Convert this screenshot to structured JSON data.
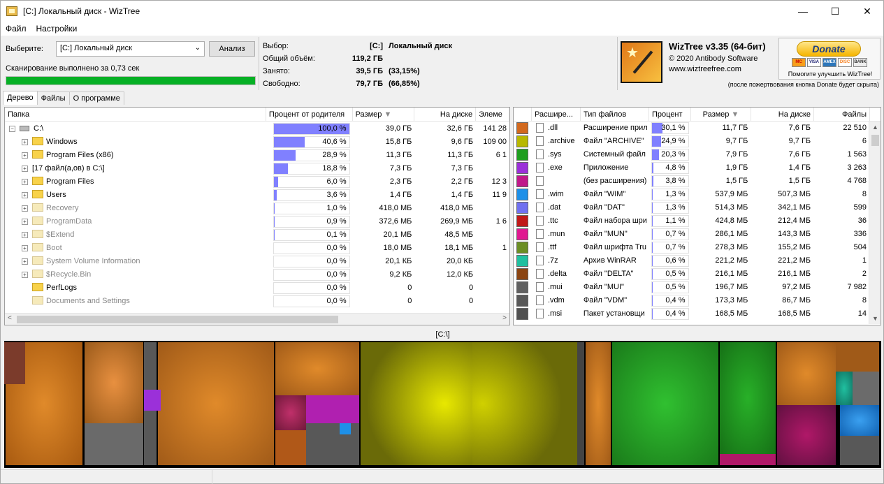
{
  "window": {
    "title": "[C:] Локальный диск  - WizTree",
    "min": "—",
    "max": "☐",
    "close": "✕"
  },
  "menu": [
    "Файл",
    "Настройки"
  ],
  "scan": {
    "select_label": "Выберите:",
    "drive_value": "[C:] Локальный диск",
    "analyze_button": "Анализ",
    "status_text": "Сканирование выполнено за 0,73 сек",
    "progress_percent": 100
  },
  "summary": {
    "selection_label": "Выбор:",
    "selection_drive": "[C:]",
    "selection_name": "Локальный диск",
    "total_label": "Общий объём:",
    "total_value": "119,2 ГБ",
    "used_label": "Занято:",
    "used_value": "39,5 ГБ",
    "used_pct": "(33,15%)",
    "free_label": "Свободно:",
    "free_value": "79,7 ГБ",
    "free_pct": "(66,85%)"
  },
  "brand": {
    "name": "WizTree v3.35 (64-бит)",
    "copyright": "© 2020 Antibody Software",
    "site": "www.wiztreefree.com",
    "donate_button": "Donate",
    "donate_caption": "Помогите улучшить WizTree!",
    "donate_note": "(после пожертвования кнопка Donate будет скрыта)",
    "cards": [
      "MC",
      "VISA",
      "AMEX",
      "DISC",
      "BANK"
    ]
  },
  "tabs": [
    "Дерево",
    "Файлы",
    "О программе"
  ],
  "tree": {
    "columns": [
      "Папка",
      "Процент от родителя",
      "Размер",
      "На диске",
      "Элеме"
    ],
    "rows": [
      {
        "name": "C:\\",
        "pct": "100,0 %",
        "pct_value": 100,
        "size": "39,0 ГБ",
        "disk": "32,6 ГБ",
        "items": "141 28",
        "level": 0,
        "kind": "drive"
      },
      {
        "name": "Windows",
        "pct": "40,6 %",
        "pct_value": 40.6,
        "size": "15,8 ГБ",
        "disk": "9,6 ГБ",
        "items": "109 00",
        "level": 1,
        "kind": "folder"
      },
      {
        "name": "Program Files (x86)",
        "pct": "28,9 %",
        "pct_value": 28.9,
        "size": "11,3 ГБ",
        "disk": "11,3 ГБ",
        "items": "6 1",
        "level": 1,
        "kind": "folder"
      },
      {
        "name": "[17 файл(а,ов) в C:\\]",
        "pct": "18,8 %",
        "pct_value": 18.8,
        "size": "7,3 ГБ",
        "disk": "7,3 ГБ",
        "items": "",
        "level": 1,
        "kind": "files"
      },
      {
        "name": "Program Files",
        "pct": "6,0 %",
        "pct_value": 6.0,
        "size": "2,3 ГБ",
        "disk": "2,2 ГБ",
        "items": "12 3",
        "level": 1,
        "kind": "folder"
      },
      {
        "name": "Users",
        "pct": "3,6 %",
        "pct_value": 3.6,
        "size": "1,4 ГБ",
        "disk": "1,4 ГБ",
        "items": "11 9",
        "level": 1,
        "kind": "folder"
      },
      {
        "name": "Recovery",
        "pct": "1,0 %",
        "pct_value": 1.0,
        "size": "418,0 МБ",
        "disk": "418,0 МБ",
        "items": "",
        "level": 1,
        "kind": "system"
      },
      {
        "name": "ProgramData",
        "pct": "0,9 %",
        "pct_value": 0.9,
        "size": "372,6 МБ",
        "disk": "269,9 МБ",
        "items": "1 6",
        "level": 1,
        "kind": "system"
      },
      {
        "name": "$Extend",
        "pct": "0,1 %",
        "pct_value": 0.1,
        "size": "20,1 МБ",
        "disk": "48,5 МБ",
        "items": "",
        "level": 1,
        "kind": "system"
      },
      {
        "name": "Boot",
        "pct": "0,0 %",
        "pct_value": 0,
        "size": "18,0 МБ",
        "disk": "18,1 МБ",
        "items": "1",
        "level": 1,
        "kind": "system"
      },
      {
        "name": "System Volume Information",
        "pct": "0,0 %",
        "pct_value": 0,
        "size": "20,1 КБ",
        "disk": "20,0 КБ",
        "items": "",
        "level": 1,
        "kind": "system"
      },
      {
        "name": "$Recycle.Bin",
        "pct": "0,0 %",
        "pct_value": 0,
        "size": "9,2 КБ",
        "disk": "12,0 КБ",
        "items": "",
        "level": 1,
        "kind": "system"
      },
      {
        "name": "PerfLogs",
        "pct": "0,0 %",
        "pct_value": 0,
        "size": "0",
        "disk": "0",
        "items": "",
        "level": 1,
        "kind": "folder-noexp"
      },
      {
        "name": "Documents and Settings",
        "pct": "0,0 %",
        "pct_value": 0,
        "size": "0",
        "disk": "0",
        "items": "",
        "level": 1,
        "kind": "system-noexp"
      }
    ]
  },
  "types": {
    "columns": [
      "",
      "Расшире...",
      "Тип файлов",
      "Процент",
      "Размер",
      "На диске",
      "Файлы"
    ],
    "rows": [
      {
        "color": "#d2691e",
        "ext": ".dll",
        "type": "Расширение прил",
        "pct": "30,1 %",
        "pct_value": 30.1,
        "size": "11,7 ГБ",
        "disk": "7,6 ГБ",
        "files": "22 510"
      },
      {
        "color": "#b8b800",
        "ext": ".archive",
        "type": "Файл \"ARCHIVE\"",
        "pct": "24,9 %",
        "pct_value": 24.9,
        "size": "9,7 ГБ",
        "disk": "9,7 ГБ",
        "files": "6"
      },
      {
        "color": "#1e9e1e",
        "ext": ".sys",
        "type": "Системный файл",
        "pct": "20,3 %",
        "pct_value": 20.3,
        "size": "7,9 ГБ",
        "disk": "7,6 ГБ",
        "files": "1 563"
      },
      {
        "color": "#9b30d9",
        "ext": ".exe",
        "type": "Приложение",
        "pct": "4,8 %",
        "pct_value": 4.8,
        "size": "1,9 ГБ",
        "disk": "1,4 ГБ",
        "files": "3 263"
      },
      {
        "color": "#c0188a",
        "ext": "",
        "type": "(без расширения)",
        "pct": "3,8 %",
        "pct_value": 3.8,
        "size": "1,5 ГБ",
        "disk": "1,5 ГБ",
        "files": "4 768"
      },
      {
        "color": "#1e90e8",
        "ext": ".wim",
        "type": "Файл \"WIM\"",
        "pct": "1,3 %",
        "pct_value": 1.3,
        "size": "537,9 МБ",
        "disk": "507,3 МБ",
        "files": "8"
      },
      {
        "color": "#7070f0",
        "ext": ".dat",
        "type": "Файл \"DAT\"",
        "pct": "1,3 %",
        "pct_value": 1.3,
        "size": "514,3 МБ",
        "disk": "342,1 МБ",
        "files": "599"
      },
      {
        "color": "#c01818",
        "ext": ".ttc",
        "type": "Файл набора шри",
        "pct": "1,1 %",
        "pct_value": 1.1,
        "size": "424,8 МБ",
        "disk": "212,4 МБ",
        "files": "36"
      },
      {
        "color": "#e01890",
        "ext": ".mun",
        "type": "Файл \"MUN\"",
        "pct": "0,7 %",
        "pct_value": 0.7,
        "size": "286,1 МБ",
        "disk": "143,3 МБ",
        "files": "336"
      },
      {
        "color": "#6b8e23",
        "ext": ".ttf",
        "type": "Файл шрифта Tru",
        "pct": "0,7 %",
        "pct_value": 0.7,
        "size": "278,3 МБ",
        "disk": "155,2 МБ",
        "files": "504"
      },
      {
        "color": "#20c0a0",
        "ext": ".7z",
        "type": "Архив WinRAR",
        "pct": "0,6 %",
        "pct_value": 0.6,
        "size": "221,2 МБ",
        "disk": "221,2 МБ",
        "files": "1"
      },
      {
        "color": "#8b4513",
        "ext": ".delta",
        "type": "Файл \"DELTA\"",
        "pct": "0,5 %",
        "pct_value": 0.5,
        "size": "216,1 МБ",
        "disk": "216,1 МБ",
        "files": "2"
      },
      {
        "color": "#606060",
        "ext": ".mui",
        "type": "Файл \"MUI\"",
        "pct": "0,5 %",
        "pct_value": 0.5,
        "size": "196,7 МБ",
        "disk": "97,2 МБ",
        "files": "7 982"
      },
      {
        "color": "#585858",
        "ext": ".vdm",
        "type": "Файл \"VDM\"",
        "pct": "0,4 %",
        "pct_value": 0.4,
        "size": "173,3 МБ",
        "disk": "86,7 МБ",
        "files": "8"
      },
      {
        "color": "#505050",
        "ext": ".msi",
        "type": "Пакет установщи",
        "pct": "0,4 %",
        "pct_value": 0.4,
        "size": "168,5 МБ",
        "disk": "168,5 МБ",
        "files": "14"
      }
    ]
  },
  "treemap": {
    "path": "[C:\\]"
  }
}
